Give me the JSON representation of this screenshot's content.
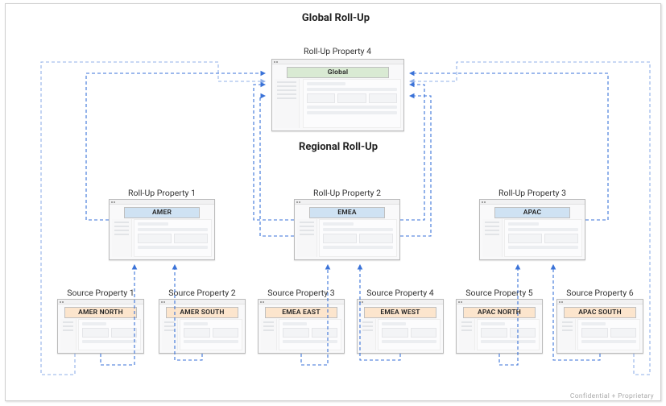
{
  "titles": {
    "global": "Global Roll-Up",
    "regional": "Regional Roll-Up"
  },
  "global_card": {
    "label": "Roll-Up Property 4",
    "band": "Global"
  },
  "regions": [
    {
      "label": "Roll-Up Property 1",
      "band": "AMER"
    },
    {
      "label": "Roll-Up Property 2",
      "band": "EMEA"
    },
    {
      "label": "Roll-Up Property 3",
      "band": "APAC"
    }
  ],
  "sources": [
    {
      "label": "Source Property 1",
      "band": "AMER NORTH"
    },
    {
      "label": "Source Property 2",
      "band": "AMER SOUTH"
    },
    {
      "label": "Source Property 3",
      "band": "EMEA EAST"
    },
    {
      "label": "Source Property 4",
      "band": "EMEA WEST"
    },
    {
      "label": "Source Property 5",
      "band": "APAC NORTH"
    },
    {
      "label": "Source Property 6",
      "band": "APAC SOUTH"
    }
  ],
  "watermark": "Confidential + Proprietary",
  "chart_data": {
    "type": "diagram",
    "title": "Global Roll-Up / Regional Roll-Up hierarchy",
    "hierarchy": {
      "name": "Roll-Up Property 4",
      "region": "Global",
      "children": [
        {
          "name": "Roll-Up Property 1",
          "region": "AMER",
          "children": [
            {
              "name": "Source Property 1",
              "region": "AMER NORTH"
            },
            {
              "name": "Source Property 2",
              "region": "AMER SOUTH"
            }
          ]
        },
        {
          "name": "Roll-Up Property 2",
          "region": "EMEA",
          "children": [
            {
              "name": "Source Property 3",
              "region": "EMEA EAST"
            },
            {
              "name": "Source Property 4",
              "region": "EMEA WEST"
            }
          ]
        },
        {
          "name": "Roll-Up Property 3",
          "region": "APAC",
          "children": [
            {
              "name": "Source Property 5",
              "region": "APAC NORTH"
            },
            {
              "name": "Source Property 6",
              "region": "APAC SOUTH"
            }
          ]
        }
      ]
    }
  }
}
